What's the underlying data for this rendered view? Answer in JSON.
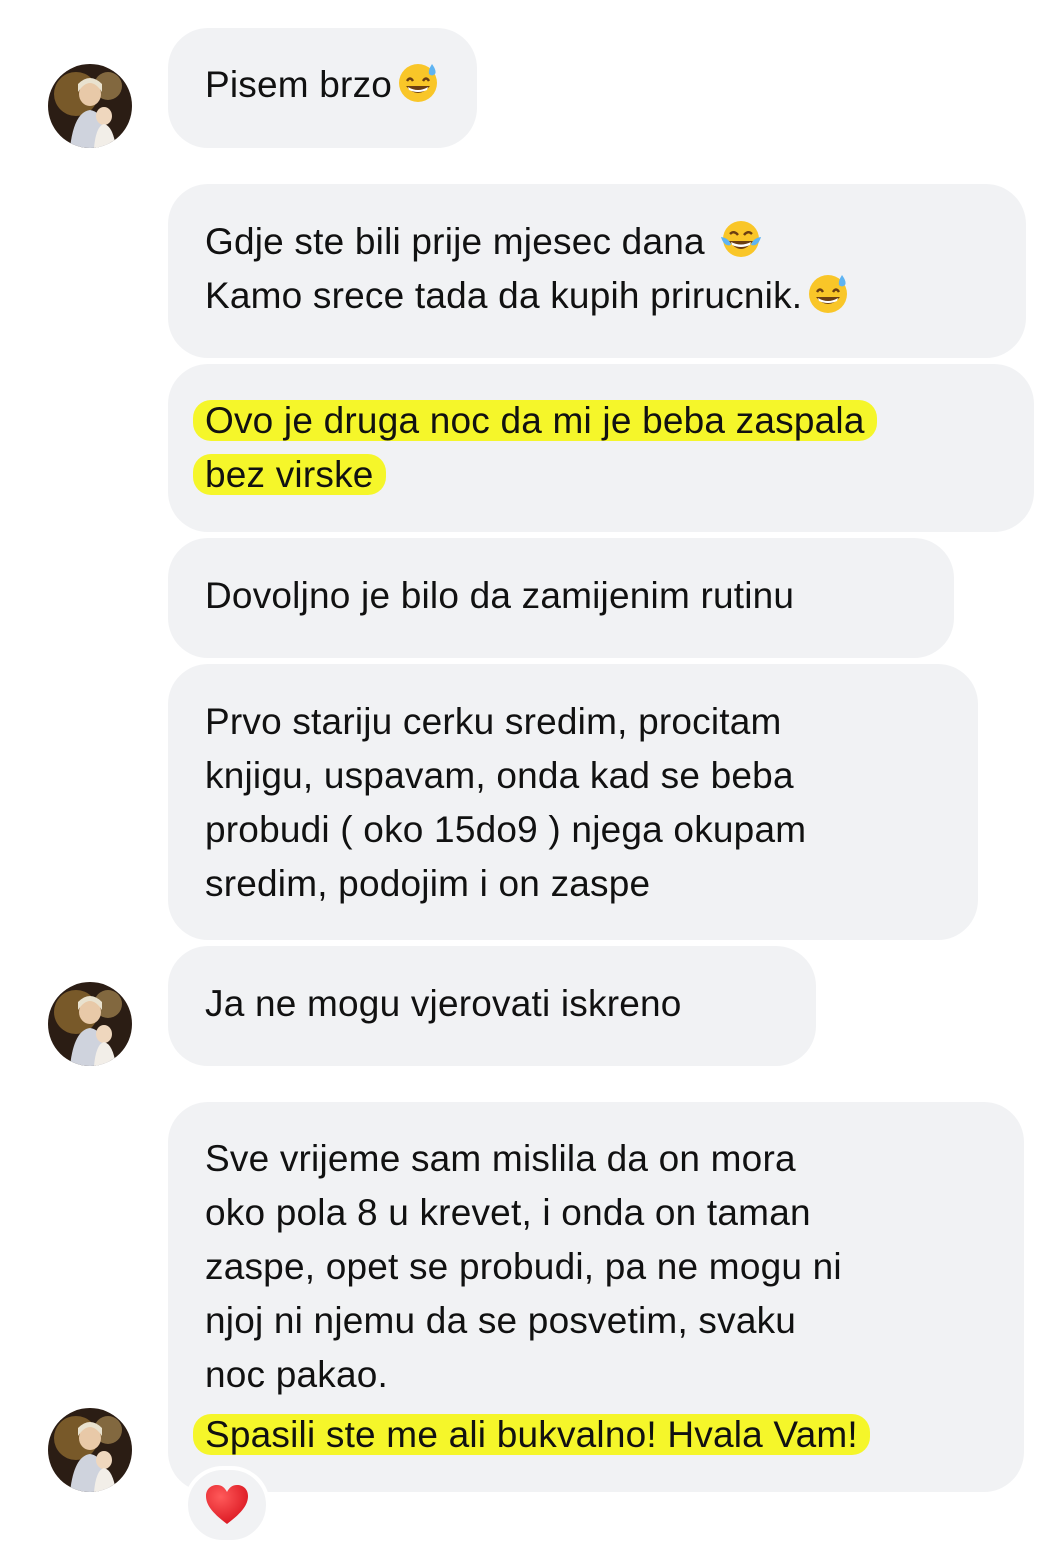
{
  "messages": [
    {
      "lines": [
        "Pisem brzo"
      ],
      "emoji_end": "grinning-sweat-emoji"
    },
    {
      "lines": [
        "Gdje ste bili prije mjesec dana ",
        "Kamo srece tada da kupih prirucnik."
      ],
      "line_emojis": [
        "tears-of-joy-emoji",
        "grinning-sweat-emoji"
      ]
    },
    {
      "lines": [
        "Ovo je druga noc da mi je beba zaspala",
        "bez virske"
      ],
      "highlighted": true
    },
    {
      "lines": [
        "Dovoljno je bilo da zamijenim rutinu"
      ]
    },
    {
      "lines": [
        "Prvo stariju cerku sredim, procitam",
        "knjigu, uspavam, onda kad se beba",
        "probudi ( oko 15do9 ) njega okupam",
        "sredim, podojim i on zaspe"
      ]
    },
    {
      "lines": [
        "Ja ne mogu vjerovati iskreno"
      ]
    },
    {
      "lines": [
        "Sve vrijeme sam mislila da on mora",
        "oko pola 8 u krevet, i onda on taman",
        "zaspe, opet se probudi, pa ne mogu ni",
        "njoj ni njemu da se posvetim, svaku",
        "noc pakao."
      ],
      "highlighted_line": "Spasili ste me ali bukvalno! Hvala Vam!"
    }
  ],
  "reaction": {
    "icon": "red-heart-icon"
  },
  "colors": {
    "bubble_bg": "#f1f2f4",
    "highlight": "#f5f62a",
    "text": "#111111"
  }
}
